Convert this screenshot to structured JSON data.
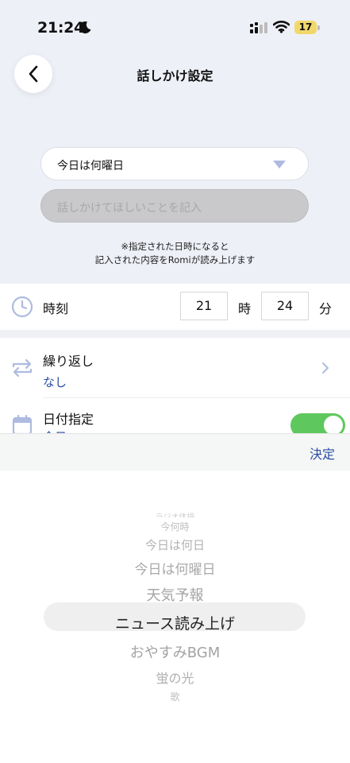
{
  "status_bar": {
    "time": "21:24",
    "battery": "17"
  },
  "header": {
    "title": "話しかけ設定"
  },
  "phrase_select": {
    "value": "今日は何曜日"
  },
  "custom_input": {
    "placeholder": "話しかけてほしいことを記入"
  },
  "note": {
    "line1": "※指定された日時になると",
    "line2": "記入された内容をRomiが読み上げます"
  },
  "time_row": {
    "label": "時刻",
    "hour": "21",
    "hour_unit": "時",
    "minute": "24",
    "minute_unit": "分"
  },
  "repeat_row": {
    "label": "繰り返し",
    "value": "なし"
  },
  "date_row": {
    "label": "日付指定",
    "value": "今日",
    "enabled": true
  },
  "toolbar": {
    "done_label": "決定"
  },
  "picker": {
    "items": [
      "ラジオ体操",
      "今何時",
      "今日は何日",
      "今日は何曜日",
      "天気予報",
      "ニュース読み上げ",
      "おやすみBGM",
      "蛍の光",
      "歌"
    ],
    "selected_index": 5
  },
  "colors": {
    "accent": "#2a4ea3",
    "toggle_on": "#5ec85e",
    "top_background": "#eef0f7"
  }
}
